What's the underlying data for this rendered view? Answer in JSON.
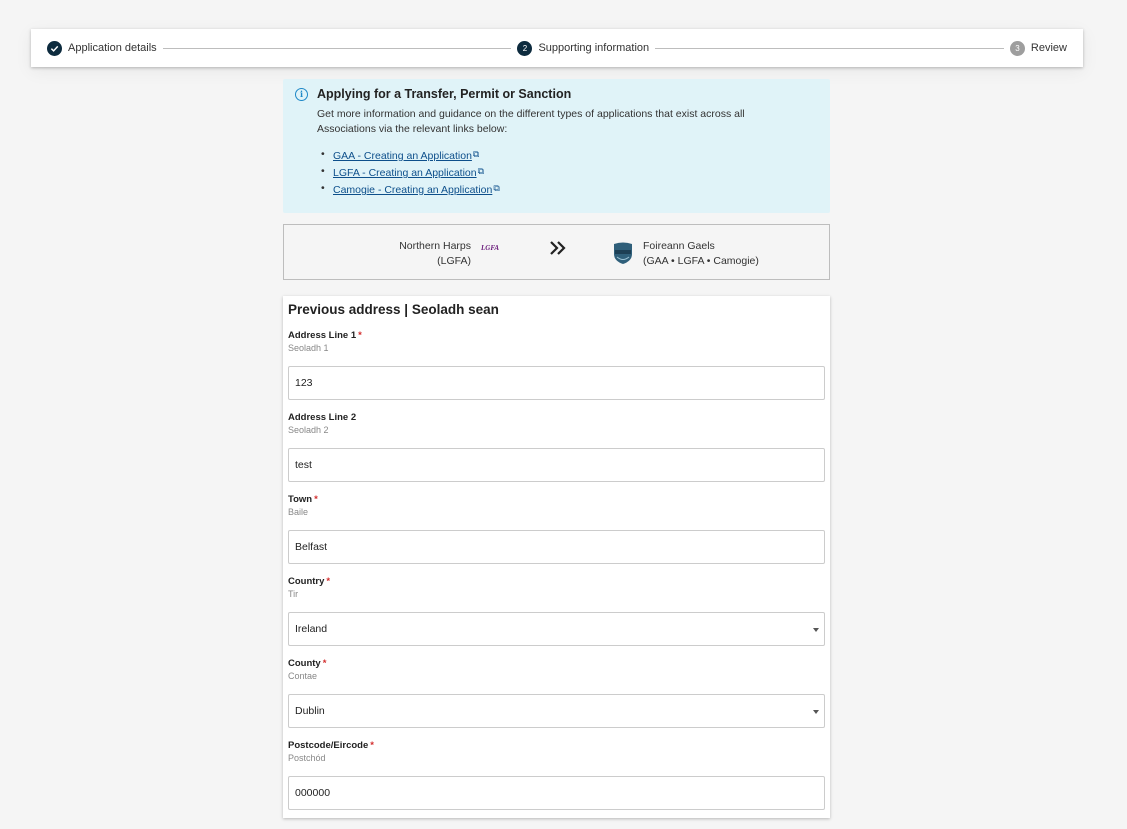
{
  "stepper": {
    "steps": [
      {
        "number": "",
        "label": "Application details",
        "state": "done"
      },
      {
        "number": "2",
        "label": "Supporting information",
        "state": "active"
      },
      {
        "number": "3",
        "label": "Review",
        "state": "todo"
      }
    ]
  },
  "info": {
    "title": "Applying for a Transfer, Permit or Sanction",
    "text": "Get more information and guidance on the different types of applications that exist across all Associations via the relevant links below:",
    "links": [
      "GAA - Creating an Application",
      "LGFA - Creating an Application",
      "Camogie - Creating an Application"
    ]
  },
  "transfer": {
    "from_name": "Northern Harps",
    "from_assoc": "(LGFA)",
    "from_logo_text": "LGFA",
    "to_name": "Foireann Gaels",
    "to_assoc": "(GAA • LGFA • Camogie)"
  },
  "address": {
    "title": "Previous address | Seoladh sean",
    "fields": [
      {
        "label": "Address Line 1",
        "required": true,
        "sub": "Seoladh 1",
        "value": "123",
        "type": "text"
      },
      {
        "label": "Address Line 2",
        "required": false,
        "sub": "Seoladh 2",
        "value": "test",
        "type": "text"
      },
      {
        "label": "Town",
        "required": true,
        "sub": "Baile",
        "value": "Belfast",
        "type": "text"
      },
      {
        "label": "Country",
        "required": true,
        "sub": "Tir",
        "value": "Ireland",
        "type": "select"
      },
      {
        "label": "County",
        "required": true,
        "sub": "Contae",
        "value": "Dublin",
        "type": "select"
      },
      {
        "label": "Postcode/Eircode",
        "required": true,
        "sub": "Postchód",
        "value": "000000",
        "type": "text"
      }
    ],
    "required_mark": "*"
  },
  "colors": {
    "accent": "#0d2b3e",
    "info_bg": "#e0f3f8",
    "link": "#0d4f8b",
    "required": "#d32f2f"
  }
}
